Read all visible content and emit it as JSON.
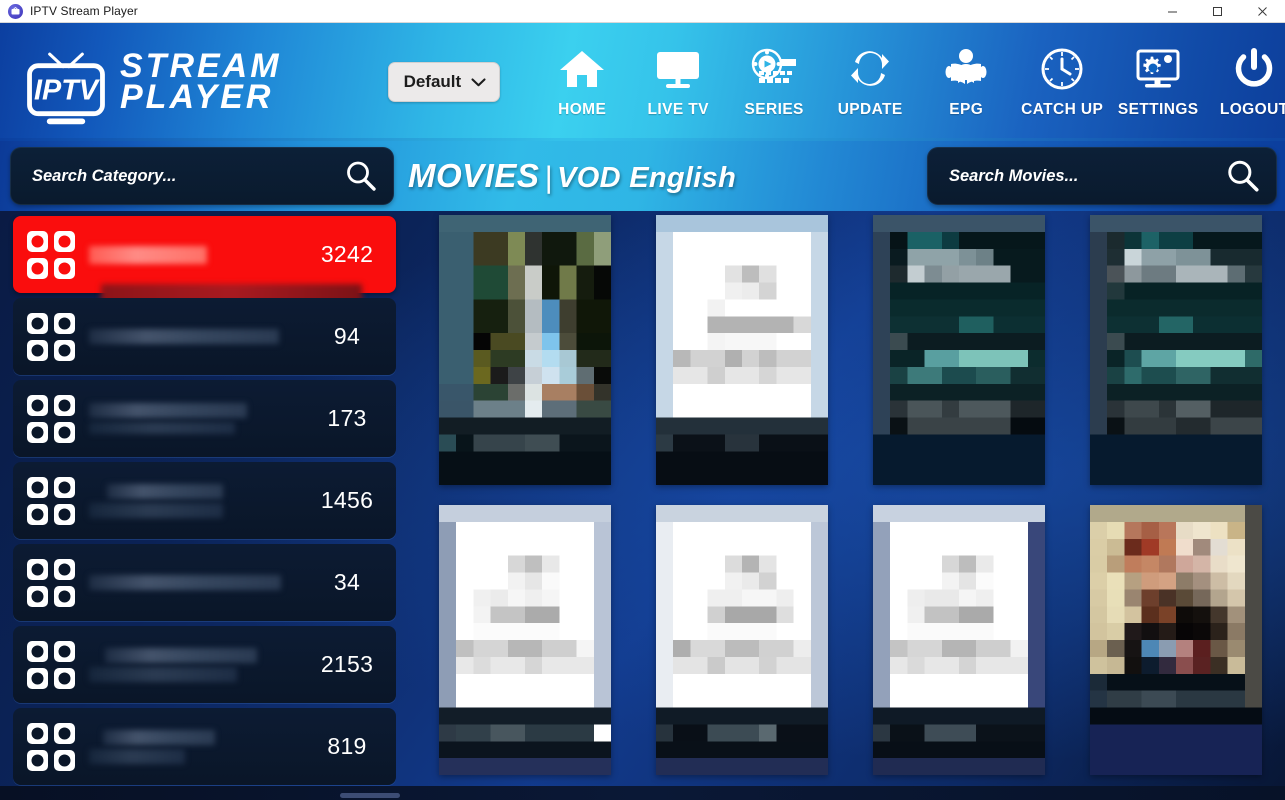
{
  "window": {
    "title": "IPTV Stream Player",
    "app_icon": "iptv-logo-icon",
    "controls": {
      "minimize": "minimize-icon",
      "maximize": "maximize-icon",
      "close": "close-icon"
    }
  },
  "brand": {
    "mark": "IPTV",
    "line1": "STREAM",
    "line2": "PLAYER"
  },
  "profile_selector": {
    "value": "Default",
    "chevron": "chevron-down-icon"
  },
  "nav": {
    "items": [
      {
        "label": "HOME",
        "icon": "home-icon"
      },
      {
        "label": "LIVE TV",
        "icon": "monitor-icon"
      },
      {
        "label": "SERIES",
        "icon": "film-play-icon"
      },
      {
        "label": "UPDATE",
        "icon": "refresh-icon"
      },
      {
        "label": "EPG",
        "icon": "person-reading-icon"
      },
      {
        "label": "CATCH UP",
        "icon": "clock-icon"
      },
      {
        "label": "SETTINGS",
        "icon": "monitor-gear-icon"
      },
      {
        "label": "LOGOUT",
        "icon": "power-icon"
      }
    ]
  },
  "search": {
    "category": {
      "value": "",
      "placeholder": "Search Category...",
      "icon": "search-icon"
    },
    "movies": {
      "value": "",
      "placeholder": "Search Movies...",
      "icon": "search-icon"
    }
  },
  "page_title": {
    "main": "MOVIES",
    "separator": "|",
    "sub": "VOD English"
  },
  "categories": {
    "icon": "grid-2x2-icon",
    "items": [
      {
        "label": "",
        "count": "3242",
        "selected": true
      },
      {
        "label": "",
        "count": "94",
        "selected": false
      },
      {
        "label": "",
        "count": "173",
        "selected": false
      },
      {
        "label": "",
        "count": "1456",
        "selected": false
      },
      {
        "label": "",
        "count": "34",
        "selected": false
      },
      {
        "label": "",
        "count": "2153",
        "selected": false
      },
      {
        "label": "",
        "count": "819",
        "selected": false
      }
    ]
  },
  "posters": {
    "items": [
      {
        "title": "",
        "palette": "olive-green-figure"
      },
      {
        "title": "",
        "palette": "white-poster"
      },
      {
        "title": "",
        "palette": "dark-teal"
      },
      {
        "title": "",
        "palette": "dark-teal"
      },
      {
        "title": "",
        "palette": "white-poster"
      },
      {
        "title": "",
        "palette": "white-poster"
      },
      {
        "title": "",
        "palette": "white-poster"
      },
      {
        "title": "",
        "palette": "warm-tan-portrait"
      }
    ]
  },
  "colors": {
    "accent_selected": "#FA0D0D",
    "header_cyan": "#35C3EA",
    "header_blue": "#0C3FA0",
    "panel_dark": "#0A1628",
    "text_light": "#FFFFFF"
  }
}
